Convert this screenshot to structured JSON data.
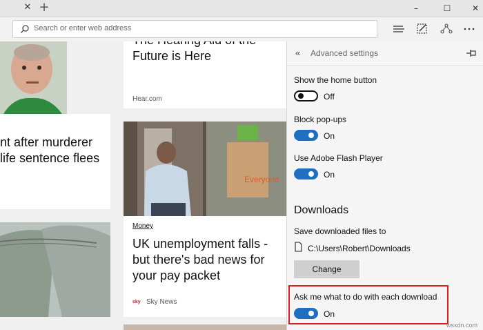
{
  "browser": {
    "address_placeholder": "Search or enter web address",
    "tab_close": "✕",
    "tab_new": "+",
    "window": {
      "minimize": "–",
      "maximize": "☐",
      "close": "✕"
    }
  },
  "feed": {
    "top_headline": "The Hearing Aid of the Future is Here",
    "top_source": "Hear.com",
    "left_headline_1": "nt after murderer",
    "left_headline_2": "life sentence flees",
    "money_tag": "Money",
    "main_headline": "UK unemployment falls - but there's bad news for your pay packet",
    "main_source": "Sky News",
    "photo_sign": "Everyone"
  },
  "settings": {
    "title": "Advanced settings",
    "home_button_label": "Show the home button",
    "home_button_state": "Off",
    "popups_label": "Block pop-ups",
    "popups_state": "On",
    "flash_label": "Use Adobe Flash Player",
    "flash_state": "On",
    "downloads_heading": "Downloads",
    "save_label": "Save downloaded files to",
    "download_path": "C:\\Users\\Robert\\Downloads",
    "change_button": "Change",
    "ask_label": "Ask me what to do with each download",
    "ask_state": "On"
  },
  "watermark": "wsxdn.com",
  "colors": {
    "accent": "#1e6fbf",
    "highlight": "#e02020"
  }
}
